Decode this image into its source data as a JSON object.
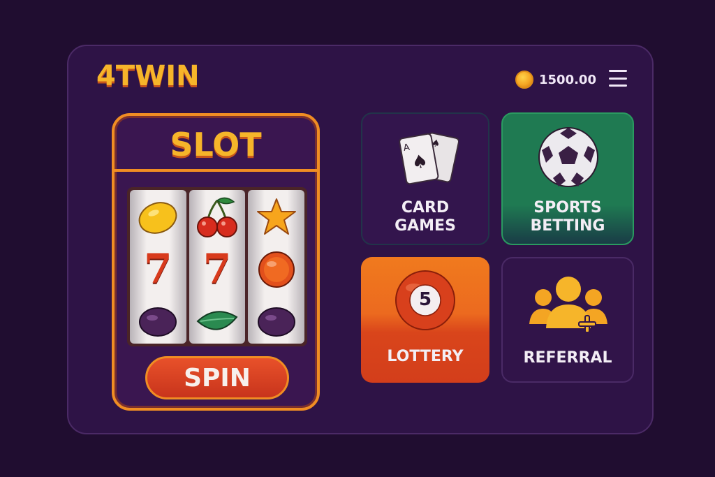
{
  "header": {
    "brand": "4TWIN",
    "balance": "1500.00",
    "coin_icon": "coin-icon",
    "menu_icon": "hamburger-menu-icon"
  },
  "slot": {
    "title": "SLOT",
    "reels": [
      [
        "lemon",
        "7",
        "plum"
      ],
      [
        "cherries",
        "7",
        "leaf"
      ],
      [
        "star",
        "orange",
        "plum"
      ]
    ],
    "seven_label": "7",
    "spin_label": "SPIN"
  },
  "tiles": [
    {
      "id": "card-games",
      "label_line1": "CARD",
      "label_line2": "GAMES",
      "icon": "playing-cards-icon"
    },
    {
      "id": "sports-betting",
      "label_line1": "SPORTS",
      "label_line2": "BETTING",
      "icon": "soccer-ball-icon"
    },
    {
      "id": "lottery",
      "label": "LOTTERY",
      "ball_number": "5",
      "icon": "lottery-ball-icon"
    },
    {
      "id": "referral",
      "label": "REFERRAL",
      "icon": "add-users-icon"
    }
  ],
  "colors": {
    "background": "#200d30",
    "panel": "#2e1346",
    "accent_orange": "#f08d23",
    "brand_gold": "#f6b52a",
    "sports_green": "#1f7a52",
    "lottery_red": "#d33e1b"
  }
}
